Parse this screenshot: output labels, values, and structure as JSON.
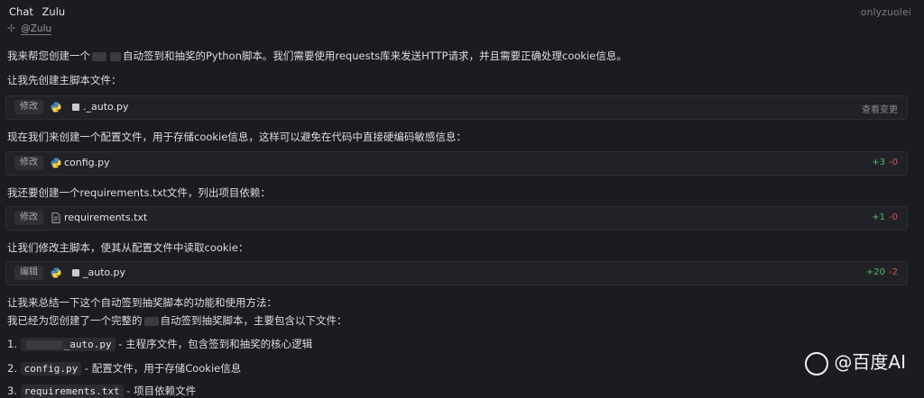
{
  "header": {
    "tabs": [
      "Chat",
      "Zulu"
    ],
    "brand": "onlyzuolei"
  },
  "mention": {
    "text": "@Zulu"
  },
  "messages": {
    "intro_prefix": "我来帮您创建一个",
    "intro_suffix": "自动签到和抽奖的Python脚本。我们需要使用requests库来发送HTTP请求，并且需要正确处理cookie信息。",
    "step1": "让我先创建主脚本文件：",
    "step2": "现在我们来创建一个配置文件，用于存储cookie信息，这样可以避免在代码中直接硬编码敏感信息：",
    "step3": "我还要创建一个requirements.txt文件，列出项目依赖：",
    "step4": "让我们修改主脚本，使其从配置文件中读取cookie：",
    "summary1": "让我来总结一下这个自动签到抽奖脚本的功能和使用方法：",
    "summary2_prefix": "我已经为您创建了一个完整的",
    "summary2_suffix": "自动签到抽奖脚本，主要包含以下文件："
  },
  "files": [
    {
      "action": "修改",
      "name": "._auto.py",
      "right": "查看变更"
    },
    {
      "action": "修改",
      "name": "config.py",
      "add": "+3",
      "del": "-0"
    },
    {
      "action": "修改",
      "name": "requirements.txt",
      "add": "+1",
      "del": "-0"
    },
    {
      "action": "编辑",
      "name": "_auto.py",
      "add": "+20",
      "del": "-2"
    }
  ],
  "list": [
    {
      "num": "1.",
      "code": "_auto.py",
      "desc": " - 主程序文件，包含签到和抽奖的核心逻辑"
    },
    {
      "num": "2.",
      "code": "config.py",
      "desc": " - 配置文件，用于存储Cookie信息"
    },
    {
      "num": "3.",
      "code": "requirements.txt",
      "desc": " - 项目依赖文件"
    }
  ],
  "watermark": {
    "text": "@百度AI"
  },
  "colors": {
    "background": "#1b1c20",
    "add": "#4fbf6a",
    "del": "#d9534f"
  }
}
